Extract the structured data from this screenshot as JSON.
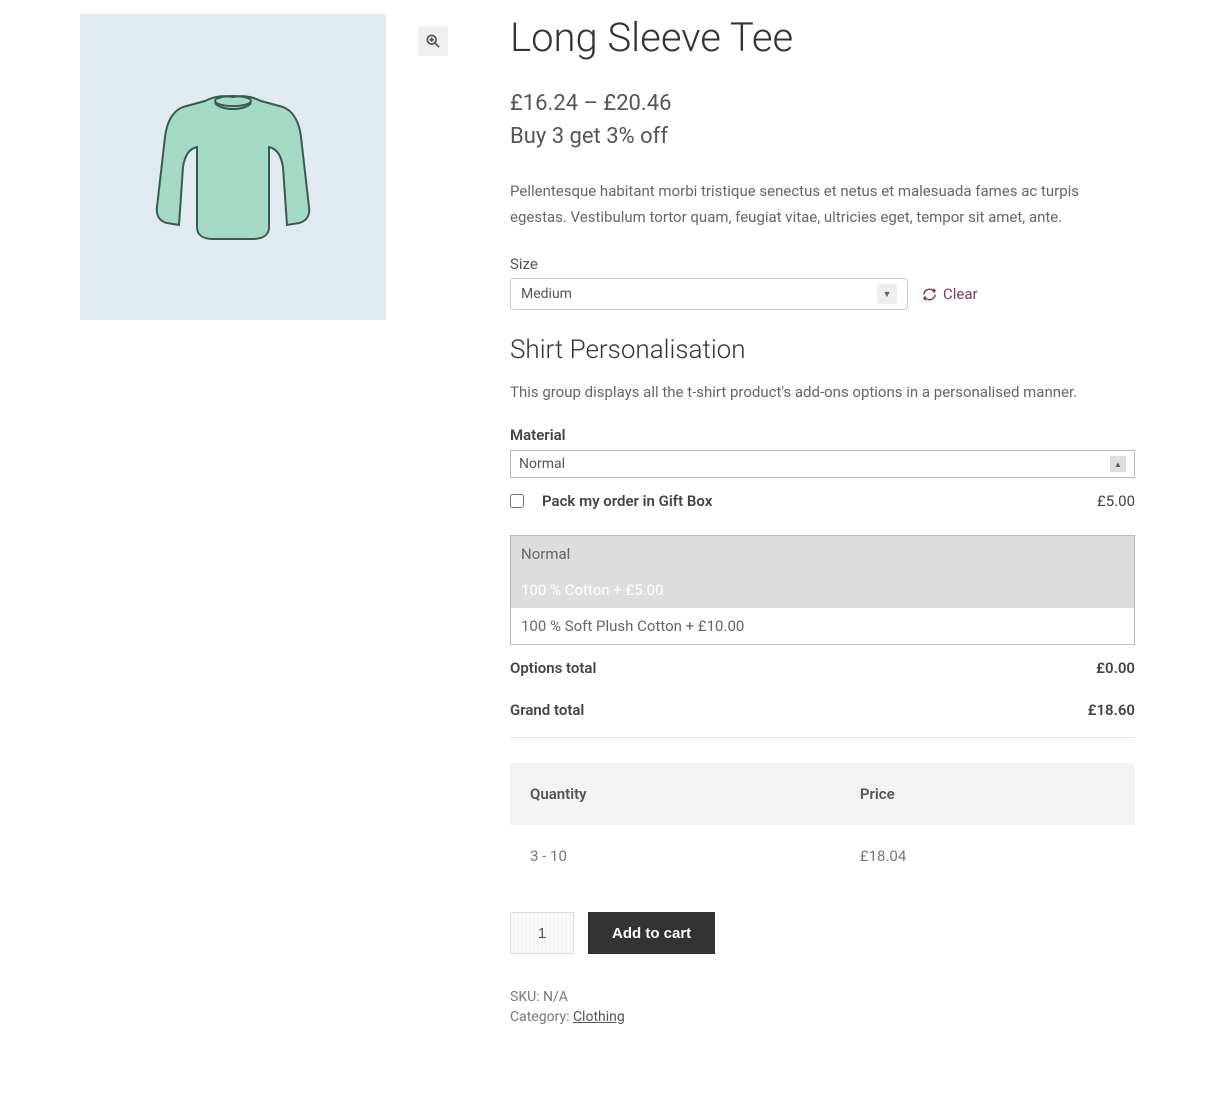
{
  "product": {
    "title": "Long Sleeve Tee",
    "price_range": "£16.24 – £20.46",
    "offer": "Buy 3 get 3% off",
    "description": "Pellentesque habitant morbi tristique senectus et netus et malesuada fames ac turpis egestas. Vestibulum tortor quam, feugiat vitae, ultricies eget, tempor sit amet, ante."
  },
  "size": {
    "label": "Size",
    "selected": "Medium",
    "clear_label": "Clear"
  },
  "personalisation": {
    "heading": "Shirt Personalisation",
    "description": "This group displays all the t-shirt product's add-ons options in a personalised manner."
  },
  "material": {
    "label": "Material",
    "selected": "Normal",
    "options": [
      "Normal",
      "100 % Cotton + £5.00",
      "100 % Soft Plush Cotton + £10.00"
    ]
  },
  "giftbox": {
    "label": "Pack my order in Gift Box",
    "price": "£5.00"
  },
  "totals": {
    "options_label": "Options total",
    "options_value": "£0.00",
    "grand_label": "Grand total",
    "grand_value": "£18.60"
  },
  "price_table": {
    "head_qty": "Quantity",
    "head_price": "Price",
    "row_qty": "3 - 10",
    "row_price": "£18.04"
  },
  "cart": {
    "qty_value": "1",
    "button_label": "Add to cart"
  },
  "meta": {
    "sku_label": "SKU: ",
    "sku_value": "N/A",
    "category_label": "Category: ",
    "category_link": "Clothing"
  }
}
